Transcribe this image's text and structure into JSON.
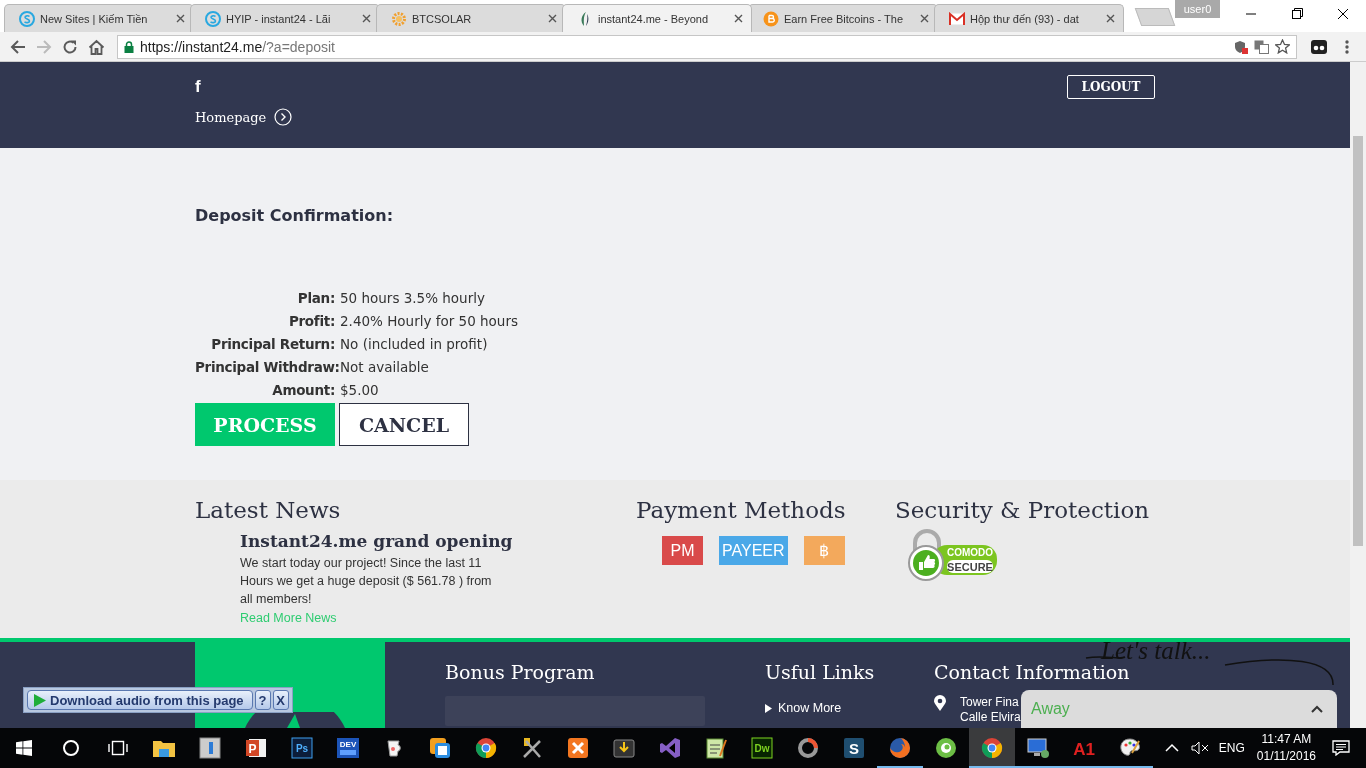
{
  "browser": {
    "tabs": [
      {
        "title": "New Sites | Kiếm Tiền",
        "kind": "s-circle",
        "selected": false
      },
      {
        "title": "HYIP - instant24 - Lãi",
        "kind": "s-circle",
        "selected": false
      },
      {
        "title": "BTCSOLAR",
        "kind": "gear",
        "selected": false
      },
      {
        "title": "instant24.me - Beyond",
        "kind": "leaf",
        "selected": true
      },
      {
        "title": "Earn Free Bitcoins - The",
        "kind": "coin",
        "selected": false
      },
      {
        "title": "Hộp thư đến (93) - dat",
        "kind": "mail",
        "selected": false
      }
    ],
    "profile": "user0",
    "back": {
      "disabled": false
    },
    "forward": {
      "disabled": true
    },
    "url": {
      "host": "https://instant24.me",
      "path": "/?a=deposit"
    }
  },
  "header": {
    "social": "f",
    "homepage": "Homepage",
    "logout": "LOGOUT"
  },
  "deposit": {
    "title": "Deposit Confirmation:",
    "rows": [
      {
        "label": "Plan:",
        "value": "50 hours 3.5% hourly"
      },
      {
        "label": "Profit:",
        "value": "2.40% Hourly for 50 hours"
      },
      {
        "label": "Principal Return:",
        "value": "No (included in profit)"
      },
      {
        "label": "Principal Withdraw:",
        "value": "Not available"
      },
      {
        "label": "Amount:",
        "value": "$5.00"
      }
    ],
    "buttons": [
      {
        "label": "PROCESS",
        "kind": "primary"
      },
      {
        "label": "CANCEL",
        "kind": "secondary"
      }
    ]
  },
  "news": {
    "heading": "Latest News",
    "items": [
      {
        "title": "Instant24.me grand opening",
        "text": "We start today our project! Since the last 11 Hours we get a huge deposit ($ 561.78 ) from all members!",
        "link": "Read More News"
      }
    ]
  },
  "payments": {
    "heading": "Payment Methods",
    "methods": [
      {
        "kind": "pm",
        "label": "PM"
      },
      {
        "kind": "payeer",
        "label": "PAYEER"
      },
      {
        "kind": "bitcoin",
        "label": "฿"
      }
    ]
  },
  "security": {
    "heading": "Security & Protection",
    "badge": {
      "top": "COMODO",
      "bottom": "SECURE"
    }
  },
  "footer": {
    "bonus": {
      "heading": "Bonus Program"
    },
    "links": {
      "heading": "Usful Links",
      "items": [
        "Know More"
      ]
    },
    "contact": {
      "heading": "Contact Information",
      "address": [
        "Tower Fina",
        "Calle Elvira"
      ]
    }
  },
  "download_bar": {
    "label": "Download audio from this page",
    "help": "?",
    "close": "X"
  },
  "chat": {
    "tagline": "Let's talk...",
    "status": "Away"
  },
  "taskbar": {
    "apps": [
      {
        "kind": "folder",
        "running": false,
        "selected": false
      },
      {
        "kind": "store",
        "running": false,
        "selected": false
      },
      {
        "kind": "powerpoint",
        "glyph": "P",
        "running": false,
        "selected": false
      },
      {
        "kind": "photoshop",
        "glyph": "Ps",
        "running": false,
        "selected": false
      },
      {
        "kind": "devcpp",
        "glyph": "DEV",
        "running": false,
        "selected": false
      },
      {
        "kind": "jug",
        "running": false,
        "selected": false
      },
      {
        "kind": "boxes",
        "running": false,
        "selected": false
      },
      {
        "kind": "chrome",
        "running": false,
        "selected": false
      },
      {
        "kind": "tools",
        "running": false,
        "selected": false
      },
      {
        "kind": "xampp",
        "running": false,
        "selected": false
      },
      {
        "kind": "download",
        "running": false,
        "selected": false
      },
      {
        "kind": "vs",
        "running": false,
        "selected": false
      },
      {
        "kind": "notepad",
        "running": false,
        "selected": false
      },
      {
        "kind": "dreamweaver",
        "glyph": "Dw",
        "running": false,
        "selected": false
      },
      {
        "kind": "ring",
        "running": false,
        "selected": false
      },
      {
        "kind": "sublime",
        "glyph": "S",
        "running": false,
        "selected": false
      },
      {
        "kind": "firefox",
        "running": true,
        "selected": false
      },
      {
        "kind": "coccoc",
        "running": false,
        "selected": false
      },
      {
        "kind": "chrome",
        "running": true,
        "selected": true
      },
      {
        "kind": "remote",
        "running": true,
        "selected": false
      },
      {
        "kind": "a1",
        "glyph": "A1",
        "running": true,
        "selected": false
      },
      {
        "kind": "paint",
        "running": true,
        "selected": false
      }
    ],
    "language": "ENG",
    "time": "11:47 AM",
    "date": "01/11/2016"
  }
}
